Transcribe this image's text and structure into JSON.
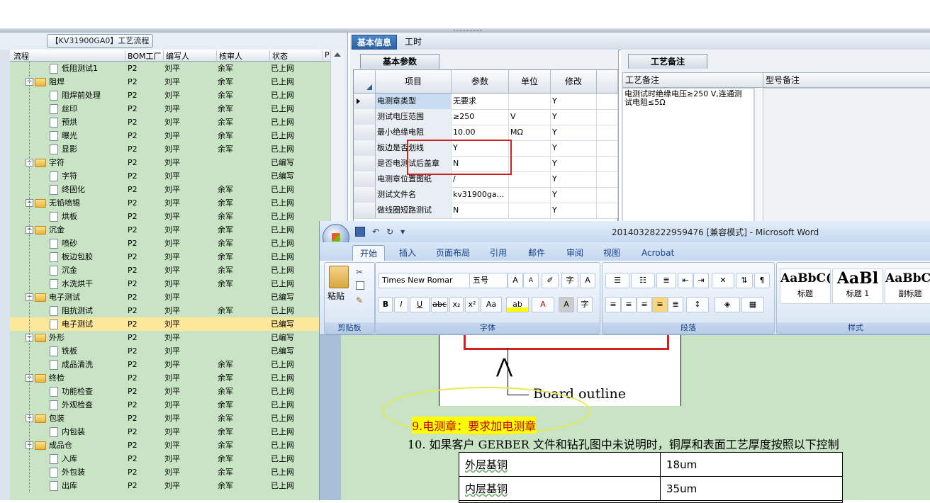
{
  "left_panel": {
    "title": "【KV31900GA0】工艺流程",
    "columns": [
      "流程",
      "BOM工厂",
      "编写人",
      "核审人",
      "状态",
      "P"
    ],
    "rows": [
      {
        "name": "低阻测试1",
        "type": "doc",
        "level": 2,
        "bom": "P2",
        "writer": "刘平",
        "reviewer": "余军",
        "status": "已上网"
      },
      {
        "name": "阻焊",
        "type": "folder",
        "level": 1,
        "bom": "P2",
        "writer": "刘平",
        "reviewer": "余军",
        "status": "已上网"
      },
      {
        "name": "阻焊前处理",
        "type": "doc",
        "level": 2,
        "bom": "P2",
        "writer": "刘平",
        "reviewer": "余军",
        "status": "已上网"
      },
      {
        "name": "丝印",
        "type": "doc",
        "level": 2,
        "bom": "P2",
        "writer": "刘平",
        "reviewer": "余军",
        "status": "已上网"
      },
      {
        "name": "预烘",
        "type": "doc",
        "level": 2,
        "bom": "P2",
        "writer": "刘平",
        "reviewer": "余军",
        "status": "已上网"
      },
      {
        "name": "曝光",
        "type": "doc",
        "level": 2,
        "bom": "P2",
        "writer": "刘平",
        "reviewer": "余军",
        "status": "已上网"
      },
      {
        "name": "显影",
        "type": "doc",
        "level": 2,
        "bom": "P2",
        "writer": "刘平",
        "reviewer": "余军",
        "status": "已上网"
      },
      {
        "name": "字符",
        "type": "folder",
        "level": 1,
        "bom": "P2",
        "writer": "刘平",
        "reviewer": "",
        "status": "已编写"
      },
      {
        "name": "字符",
        "type": "doc",
        "level": 2,
        "bom": "P2",
        "writer": "刘平",
        "reviewer": "",
        "status": "已编写"
      },
      {
        "name": "终固化",
        "type": "doc",
        "level": 2,
        "bom": "P2",
        "writer": "刘平",
        "reviewer": "余军",
        "status": "已上网"
      },
      {
        "name": "无铅喷锡",
        "type": "folder",
        "level": 1,
        "bom": "P2",
        "writer": "刘平",
        "reviewer": "余军",
        "status": "已上网"
      },
      {
        "name": "烘板",
        "type": "doc",
        "level": 2,
        "bom": "P2",
        "writer": "刘平",
        "reviewer": "余军",
        "status": "已上网"
      },
      {
        "name": "沉金",
        "type": "folder",
        "level": 1,
        "bom": "P2",
        "writer": "刘平",
        "reviewer": "余军",
        "status": "已上网"
      },
      {
        "name": "喷砂",
        "type": "doc",
        "level": 2,
        "bom": "P2",
        "writer": "刘平",
        "reviewer": "余军",
        "status": "已上网"
      },
      {
        "name": "板边包胶",
        "type": "doc",
        "level": 2,
        "bom": "P2",
        "writer": "刘平",
        "reviewer": "余军",
        "status": "已上网"
      },
      {
        "name": "沉金",
        "type": "doc",
        "level": 2,
        "bom": "P2",
        "writer": "刘平",
        "reviewer": "余军",
        "status": "已上网"
      },
      {
        "name": "水洗烘干",
        "type": "doc",
        "level": 2,
        "bom": "P2",
        "writer": "刘平",
        "reviewer": "余军",
        "status": "已上网"
      },
      {
        "name": "电子测试",
        "type": "folder",
        "level": 1,
        "bom": "P2",
        "writer": "刘平",
        "reviewer": "",
        "status": "已编写"
      },
      {
        "name": "阻抗测试",
        "type": "doc",
        "level": 2,
        "bom": "P2",
        "writer": "刘平",
        "reviewer": "余军",
        "status": "已上网"
      },
      {
        "name": "电子测试",
        "type": "doc",
        "level": 2,
        "bom": "P2",
        "writer": "刘平",
        "reviewer": "",
        "status": "已编写",
        "selected": true
      },
      {
        "name": "外形",
        "type": "folder",
        "level": 1,
        "bom": "P2",
        "writer": "刘平",
        "reviewer": "",
        "status": "已编写"
      },
      {
        "name": "铣板",
        "type": "doc",
        "level": 2,
        "bom": "P2",
        "writer": "刘平",
        "reviewer": "",
        "status": "已编写"
      },
      {
        "name": "成品清洗",
        "type": "doc",
        "level": 2,
        "bom": "P2",
        "writer": "刘平",
        "reviewer": "余军",
        "status": "已上网"
      },
      {
        "name": "终检",
        "type": "folder",
        "level": 1,
        "bom": "P2",
        "writer": "刘平",
        "reviewer": "余军",
        "status": "已上网"
      },
      {
        "name": "功能检查",
        "type": "doc",
        "level": 2,
        "bom": "P2",
        "writer": "刘平",
        "reviewer": "余军",
        "status": "已上网"
      },
      {
        "name": "外观检查",
        "type": "doc",
        "level": 2,
        "bom": "P2",
        "writer": "刘平",
        "reviewer": "余军",
        "status": "已上网"
      },
      {
        "name": "包装",
        "type": "folder",
        "level": 1,
        "bom": "P2",
        "writer": "刘平",
        "reviewer": "余军",
        "status": "已上网"
      },
      {
        "name": "内包装",
        "type": "doc",
        "level": 2,
        "bom": "P2",
        "writer": "刘平",
        "reviewer": "余军",
        "status": "已上网"
      },
      {
        "name": "成品仓",
        "type": "folder",
        "level": 1,
        "bom": "P2",
        "writer": "刘平",
        "reviewer": "余军",
        "status": "已上网"
      },
      {
        "name": "入库",
        "type": "doc",
        "level": 2,
        "bom": "P2",
        "writer": "刘平",
        "reviewer": "余军",
        "status": "已上网"
      },
      {
        "name": "外包装",
        "type": "doc",
        "level": 2,
        "bom": "P2",
        "writer": "刘平",
        "reviewer": "余军",
        "status": "已上网"
      },
      {
        "name": "出库",
        "type": "doc",
        "level": 2,
        "bom": "P2",
        "writer": "刘平",
        "reviewer": "余军",
        "status": "已上网"
      }
    ]
  },
  "right_tabs": [
    "基本信息",
    "工时"
  ],
  "basic_params": {
    "tab": "基本参数",
    "columns": [
      "项目",
      "参数",
      "单位",
      "修改"
    ],
    "rows": [
      {
        "item": "电测章类型",
        "param": "无要求",
        "unit": "",
        "edit": "Y",
        "current": true
      },
      {
        "item": "测试电压范围",
        "param": "≥250",
        "unit": "V",
        "edit": "Y"
      },
      {
        "item": "最小绝缘电阻",
        "param": "10.00",
        "unit": "MΩ",
        "edit": "Y"
      },
      {
        "item": "板边是否划线",
        "param": "Y",
        "unit": "",
        "edit": "Y"
      },
      {
        "item": "是否电测试后盖章",
        "param": "N",
        "unit": "",
        "edit": "Y"
      },
      {
        "item": "电测章位置图纸",
        "param": "/",
        "unit": "",
        "edit": "Y"
      },
      {
        "item": "测试文件名",
        "param": "kv31900ga...",
        "unit": "",
        "edit": "Y"
      },
      {
        "item": "做线圈短路测试",
        "param": "N",
        "unit": "",
        "edit": "Y"
      }
    ]
  },
  "process_remark": {
    "tab": "工艺备注",
    "col1": "工艺备注",
    "col2": "型号备注",
    "text": "电测试时绝缘电压≥250 V,连通测试电阻≤5Ω"
  },
  "word": {
    "title": "20140328222959476 [兼容模式] - Microsoft Word",
    "tabs": [
      "开始",
      "插入",
      "页面布局",
      "引用",
      "邮件",
      "审阅",
      "视图",
      "Acrobat"
    ],
    "clipboard": {
      "paste": "粘贴",
      "label": "剪贴板"
    },
    "font": {
      "name": "Times New Romar",
      "size": "五号",
      "label": "字体"
    },
    "paragraph_label": "段落",
    "styles": {
      "label": "样式",
      "items": [
        {
          "preview": "AaBbC(",
          "name": "标题"
        },
        {
          "preview": "AaBl",
          "name": "标题 1"
        },
        {
          "preview": "AaBbC(",
          "name": "副标题"
        }
      ]
    },
    "doc": {
      "figure_label": "Board outline",
      "line9": "9.电测章：要求加电测章",
      "line10": "10.  如果客户 GERBER 文件和钻孔图中未说明时，铜厚和表面工艺厚度按照以下控制",
      "table": [
        [
          "外层基铜",
          "18um"
        ],
        [
          "内层基铜",
          "35um"
        ]
      ]
    }
  },
  "colors": {
    "tree_bg": "#c8e4c4",
    "selected_row": "#fde79a",
    "annotation_red": "#d42020",
    "highlight": "#ffff00"
  }
}
